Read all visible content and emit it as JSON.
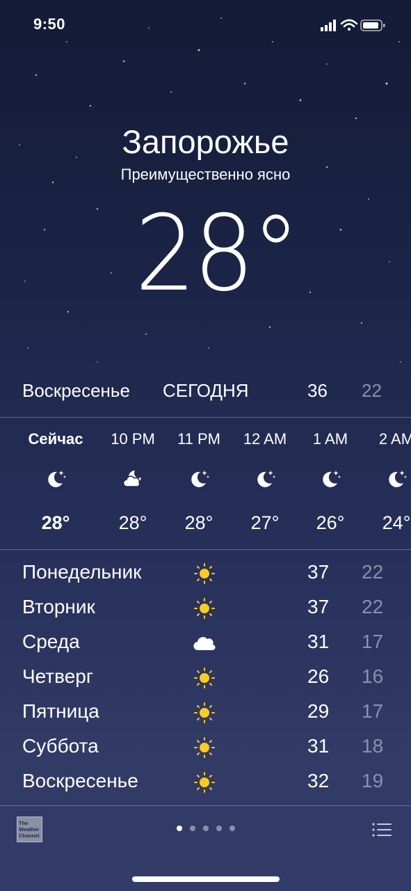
{
  "status_bar": {
    "time": "9:50",
    "signal_icon": "cellular-signal-icon",
    "wifi_icon": "wifi-icon",
    "battery_icon": "battery-icon"
  },
  "location": {
    "city": "Запорожье",
    "condition": "Преимущественно ясно",
    "temperature": "28°"
  },
  "today": {
    "day": "Воскресенье",
    "label": "СЕГОДНЯ",
    "high": "36",
    "low": "22"
  },
  "hourly": [
    {
      "time": "Сейчас",
      "icon": "moon-stars-icon",
      "temp": "28°",
      "now": true
    },
    {
      "time": "10 PM",
      "icon": "cloud-moon-icon",
      "temp": "28°"
    },
    {
      "time": "11 PM",
      "icon": "moon-stars-icon",
      "temp": "28°"
    },
    {
      "time": "12 AM",
      "icon": "moon-stars-icon",
      "temp": "27°"
    },
    {
      "time": "1 AM",
      "icon": "moon-stars-icon",
      "temp": "26°"
    },
    {
      "time": "2 AM",
      "icon": "moon-stars-icon",
      "temp": "24°"
    }
  ],
  "daily": [
    {
      "day": "Понедельник",
      "icon": "sun-icon",
      "high": "37",
      "low": "22"
    },
    {
      "day": "Вторник",
      "icon": "sun-icon",
      "high": "37",
      "low": "22"
    },
    {
      "day": "Среда",
      "icon": "cloud-icon",
      "high": "31",
      "low": "17"
    },
    {
      "day": "Четверг",
      "icon": "sun-icon",
      "high": "26",
      "low": "16"
    },
    {
      "day": "Пятница",
      "icon": "sun-icon",
      "high": "29",
      "low": "17"
    },
    {
      "day": "Суббота",
      "icon": "sun-icon",
      "high": "31",
      "low": "18"
    },
    {
      "day": "Воскресенье",
      "icon": "sun-icon",
      "high": "32",
      "low": "19"
    }
  ],
  "footer": {
    "logo_lines": [
      "The",
      "Weather",
      "Channel"
    ],
    "page_dots": 5,
    "active_page": 1,
    "list_icon": "list-icon"
  },
  "colors": {
    "low_temp": "#8b91ac",
    "sun": "#f7cd24",
    "background_top": "#141b36",
    "background_bottom": "#333c68"
  }
}
